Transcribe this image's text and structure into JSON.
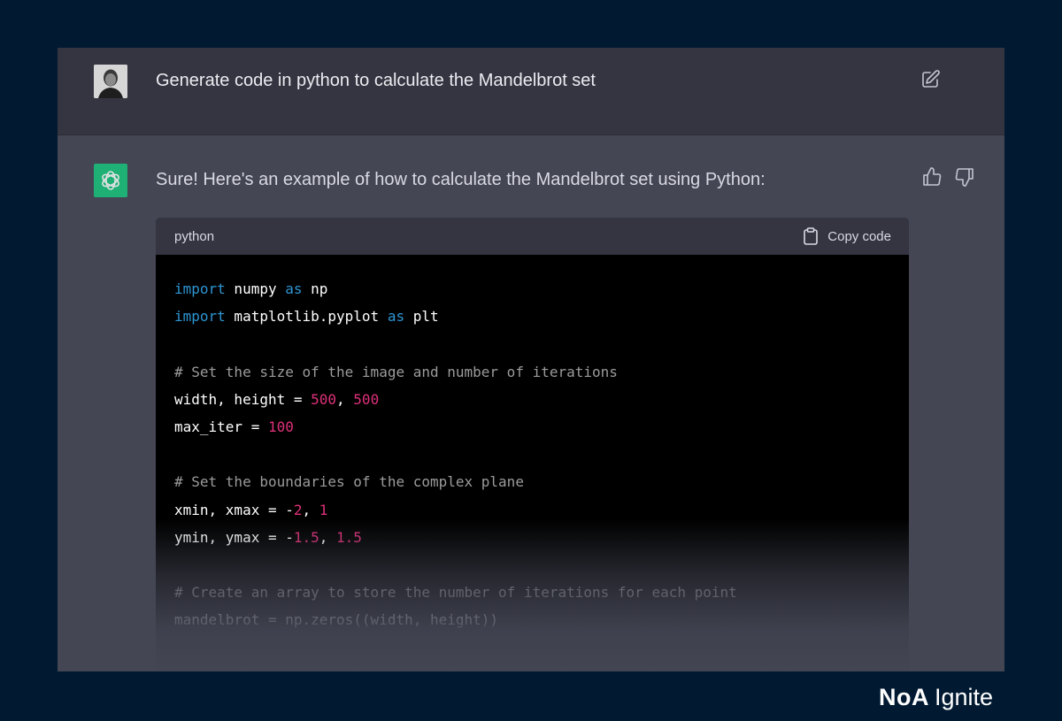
{
  "conversation": {
    "user_message": "Generate code in python to calculate the Mandelbrot set",
    "assistant_message": "Sure! Here's an example of how to calculate the Mandelbrot set using Python:",
    "icons": {
      "edit": "edit-icon",
      "thumbs_up": "thumbs-up-icon",
      "thumbs_down": "thumbs-down-icon",
      "assistant_logo": "openai-logo-icon"
    }
  },
  "code_block": {
    "language": "python",
    "copy_label": "Copy code",
    "lines": [
      [
        {
          "t": "import",
          "c": "kw"
        },
        {
          "t": " numpy ",
          "c": ""
        },
        {
          "t": "as",
          "c": "kw"
        },
        {
          "t": " np",
          "c": ""
        }
      ],
      [
        {
          "t": "import",
          "c": "kw"
        },
        {
          "t": " matplotlib.pyplot ",
          "c": ""
        },
        {
          "t": "as",
          "c": "kw"
        },
        {
          "t": " plt",
          "c": ""
        }
      ],
      [],
      [
        {
          "t": "# Set the size of the image and number of iterations",
          "c": "cm"
        }
      ],
      [
        {
          "t": "width, height = ",
          "c": ""
        },
        {
          "t": "500",
          "c": "num"
        },
        {
          "t": ", ",
          "c": ""
        },
        {
          "t": "500",
          "c": "num"
        }
      ],
      [
        {
          "t": "max_iter = ",
          "c": ""
        },
        {
          "t": "100",
          "c": "num"
        }
      ],
      [],
      [
        {
          "t": "# Set the boundaries of the complex plane",
          "c": "cm"
        }
      ],
      [
        {
          "t": "xmin, xmax = -",
          "c": ""
        },
        {
          "t": "2",
          "c": "num"
        },
        {
          "t": ", ",
          "c": ""
        },
        {
          "t": "1",
          "c": "num"
        }
      ],
      [
        {
          "t": "ymin, ymax = -",
          "c": ""
        },
        {
          "t": "1.5",
          "c": "num"
        },
        {
          "t": ", ",
          "c": ""
        },
        {
          "t": "1.5",
          "c": "num"
        }
      ],
      [],
      [
        {
          "t": "# Create an array to store the number of iterations for each point",
          "c": "cm"
        }
      ],
      [
        {
          "t": "mandelbrot = np.zeros((width, height))",
          "c": ""
        }
      ]
    ]
  },
  "branding": {
    "brand_name": "NoA",
    "brand_suffix": "Ignite"
  },
  "colors": {
    "background": "#011a32",
    "user_row": "#343541",
    "assistant_row": "#444654",
    "keyword": "#2e95d3",
    "number": "#df3079",
    "comment": "#9b9b9b",
    "assistant_avatar": "#19c37d"
  }
}
